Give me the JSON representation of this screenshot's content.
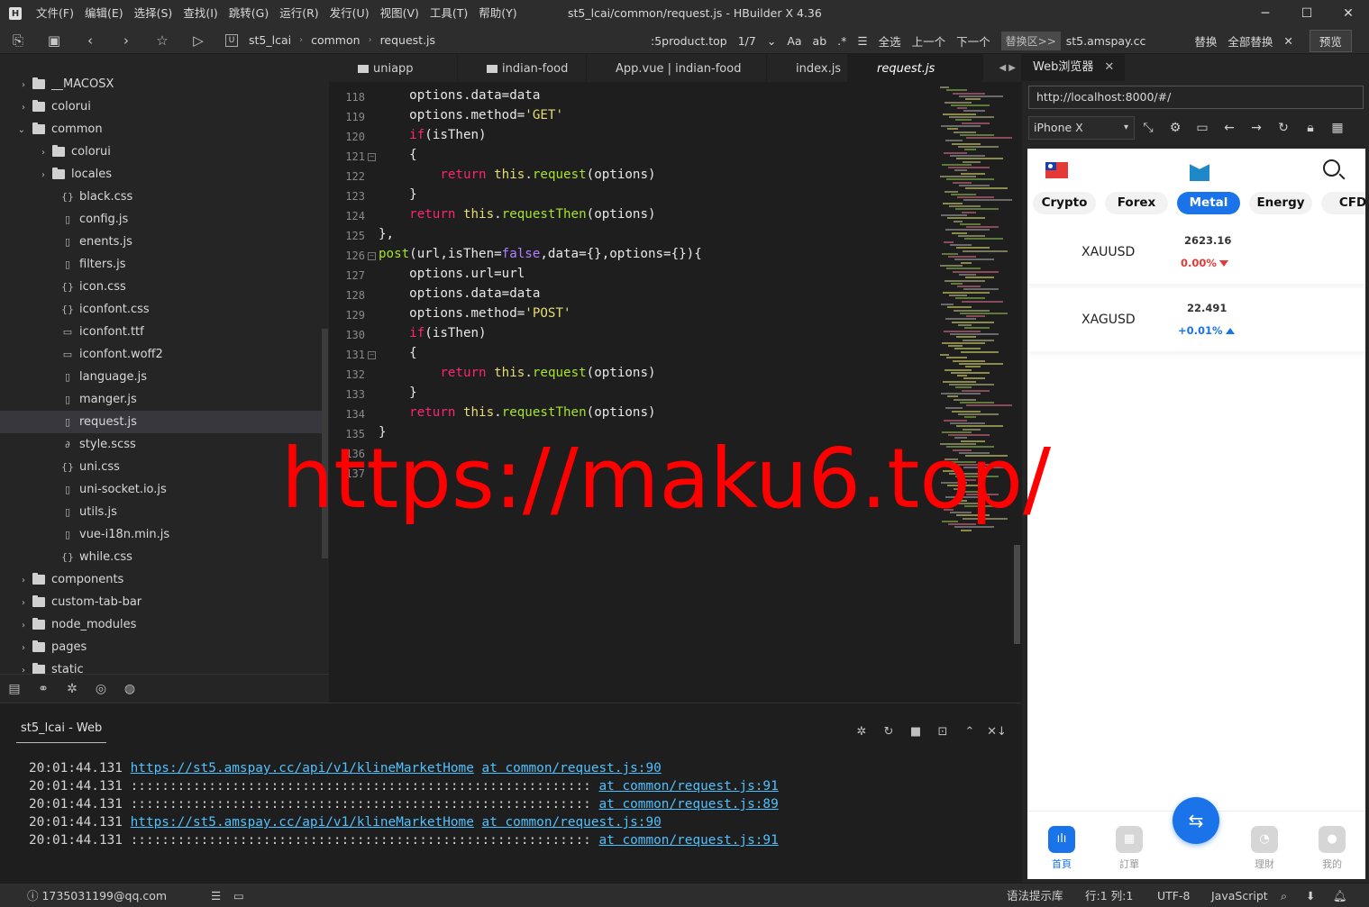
{
  "titlebar": {
    "logo": "H",
    "menu": [
      "文件(F)",
      "编辑(E)",
      "选择(S)",
      "查找(I)",
      "跳转(G)",
      "运行(R)",
      "发行(U)",
      "视图(V)",
      "工具(T)",
      "帮助(Y)"
    ],
    "title": "st5_lcai/common/request.js - HBuilder X 4.36"
  },
  "toolbar": {
    "crumb_box": "U",
    "breadcrumb": [
      "st5_lcai",
      "common",
      "request.js"
    ],
    "search_value": ":5product.top",
    "search_count": "1/7",
    "select_all": "全选",
    "prev": "上一个",
    "next": "下一个",
    "replace_area": "替换区>>",
    "replace_value": "st5.amspay.cc",
    "replace": "替换",
    "replace_all": "全部替换",
    "preview": "预览"
  },
  "sidebar": {
    "items": [
      {
        "label": "__MACOSX",
        "type": "folder",
        "indent": 0,
        "expanded": false
      },
      {
        "label": "colorui",
        "type": "folder",
        "indent": 0,
        "expanded": false
      },
      {
        "label": "common",
        "type": "folder",
        "indent": 0,
        "expanded": true
      },
      {
        "label": "colorui",
        "type": "folder",
        "indent": 1,
        "expanded": false
      },
      {
        "label": "locales",
        "type": "folder",
        "indent": 1,
        "expanded": false
      },
      {
        "label": "black.css",
        "type": "css",
        "indent": 1
      },
      {
        "label": "config.js",
        "type": "file",
        "indent": 1
      },
      {
        "label": "enents.js",
        "type": "file",
        "indent": 1
      },
      {
        "label": "filters.js",
        "type": "file",
        "indent": 1
      },
      {
        "label": "icon.css",
        "type": "css",
        "indent": 1
      },
      {
        "label": "iconfont.css",
        "type": "css",
        "indent": 1
      },
      {
        "label": "iconfont.ttf",
        "type": "blank",
        "indent": 1
      },
      {
        "label": "iconfont.woff2",
        "type": "blank",
        "indent": 1
      },
      {
        "label": "language.js",
        "type": "file",
        "indent": 1
      },
      {
        "label": "manger.js",
        "type": "file",
        "indent": 1
      },
      {
        "label": "request.js",
        "type": "file",
        "indent": 1,
        "active": true
      },
      {
        "label": "style.scss",
        "type": "scss",
        "indent": 1
      },
      {
        "label": "uni.css",
        "type": "css",
        "indent": 1
      },
      {
        "label": "uni-socket.io.js",
        "type": "file",
        "indent": 1
      },
      {
        "label": "utils.js",
        "type": "file",
        "indent": 1
      },
      {
        "label": "vue-i18n.min.js",
        "type": "file",
        "indent": 1
      },
      {
        "label": "while.css",
        "type": "css",
        "indent": 1
      },
      {
        "label": "components",
        "type": "folder",
        "indent": 0,
        "expanded": false
      },
      {
        "label": "custom-tab-bar",
        "type": "folder",
        "indent": 0,
        "expanded": false
      },
      {
        "label": "node_modules",
        "type": "folder",
        "indent": 0,
        "expanded": false
      },
      {
        "label": "pages",
        "type": "folder",
        "indent": 0,
        "expanded": false
      },
      {
        "label": "static",
        "type": "folder",
        "indent": 0,
        "expanded": false
      }
    ]
  },
  "editor": {
    "tabs": [
      {
        "label": "uniapp",
        "folder": true
      },
      {
        "label": "indian-food",
        "folder": true
      },
      {
        "label": "App.vue | indian-food",
        "folder": false
      },
      {
        "label": "index.js",
        "folder": false
      },
      {
        "label": "request.js",
        "folder": false,
        "active": true
      }
    ],
    "line_numbers": [
      "118",
      "119",
      "120",
      "121",
      "122",
      "123",
      "124",
      "125",
      "126",
      "127",
      "128",
      "129",
      "130",
      "131",
      "132",
      "133",
      "134",
      "135",
      "136",
      "137"
    ],
    "folds": [
      "121",
      "126",
      "131"
    ]
  },
  "console": {
    "tab": "st5_lcai - Web",
    "logs": [
      {
        "time": "20:01:44.131",
        "text": "https://st5.amspay.cc/api/v1/klineMarketHome",
        "text_link": true,
        "at": "at common/request.js:90"
      },
      {
        "time": "20:01:44.131",
        "text": ":::::::::::::::::::::::::::::::::::::::::::::::::::::::::::",
        "text_link": false,
        "at": "at common/request.js:91"
      },
      {
        "time": "20:01:44.131",
        "text": ":::::::::::::::::::::::::::::::::::::::::::::::::::::::::::",
        "text_link": false,
        "at": "at common/request.js:89"
      },
      {
        "time": "20:01:44.131",
        "text": "https://st5.amspay.cc/api/v1/klineMarketHome",
        "text_link": true,
        "at": "at common/request.js:90"
      },
      {
        "time": "20:01:44.131",
        "text": ":::::::::::::::::::::::::::::::::::::::::::::::::::::::::::",
        "text_link": false,
        "at": "at common/request.js:91"
      }
    ]
  },
  "statusbar": {
    "user": "1735031199@qq.com",
    "syntax_lib": "语法提示库",
    "position": "行:1  列:1",
    "encoding": "UTF-8",
    "language": "JavaScript"
  },
  "webpanel": {
    "tab": "Web浏览器",
    "url": "http://localhost:8000/#/",
    "device": "iPhone X",
    "categories": [
      "Crypto",
      "Forex",
      "Metal",
      "Energy",
      "CFD"
    ],
    "active_category": "Metal",
    "markets": [
      {
        "symbol": "XAUUSD",
        "price": "2623.16",
        "change": "0.00%",
        "direction": "down"
      },
      {
        "symbol": "XAGUSD",
        "price": "22.491",
        "change": "+0.01%",
        "direction": "up"
      }
    ],
    "nav": [
      {
        "label": "首頁",
        "active": true
      },
      {
        "label": "訂單",
        "active": false
      },
      {
        "label": "理財",
        "active": false
      },
      {
        "label": "我的",
        "active": false
      }
    ]
  },
  "watermark": "https://maku6.top/",
  "colors": {
    "accent": "#1a73e8",
    "down": "#e53935",
    "keyword": "#f92672",
    "function": "#a6e22e",
    "string": "#e6db74",
    "watermark": "#ff0000"
  }
}
